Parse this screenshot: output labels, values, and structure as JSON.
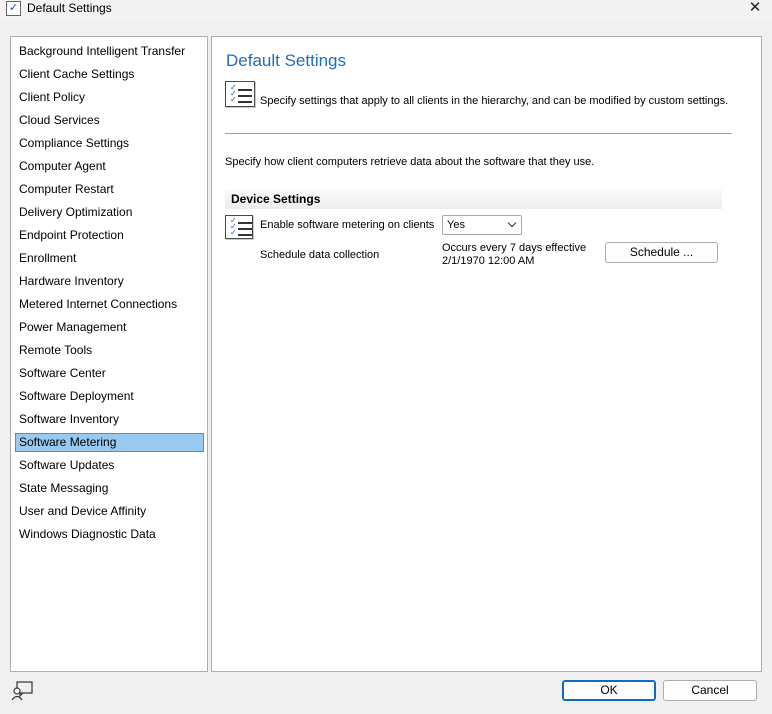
{
  "window": {
    "title": "Default Settings",
    "title_icon_glyph": "✓",
    "close_glyph": "✕"
  },
  "sidebar": {
    "selected_index": 17,
    "items": [
      {
        "label": "Background Intelligent Transfer"
      },
      {
        "label": "Client Cache Settings"
      },
      {
        "label": "Client Policy"
      },
      {
        "label": "Cloud Services"
      },
      {
        "label": "Compliance Settings"
      },
      {
        "label": "Computer Agent"
      },
      {
        "label": "Computer Restart"
      },
      {
        "label": "Delivery Optimization"
      },
      {
        "label": "Endpoint Protection"
      },
      {
        "label": "Enrollment"
      },
      {
        "label": "Hardware Inventory"
      },
      {
        "label": "Metered Internet Connections"
      },
      {
        "label": "Power Management"
      },
      {
        "label": "Remote Tools"
      },
      {
        "label": "Software Center"
      },
      {
        "label": "Software Deployment"
      },
      {
        "label": "Software Inventory"
      },
      {
        "label": "Software Metering"
      },
      {
        "label": "Software Updates"
      },
      {
        "label": "State Messaging"
      },
      {
        "label": "User and Device Affinity"
      },
      {
        "label": "Windows Diagnostic Data"
      }
    ]
  },
  "main": {
    "title": "Default Settings",
    "description": "Specify settings that apply to all clients in the hierarchy, and can be modified by custom settings.",
    "sub_description": "Specify how client computers retrieve data about the software that they use.",
    "group_title": "Device Settings",
    "settings": {
      "metering_label": "Enable software metering on clients",
      "metering_value": "Yes",
      "schedule_label": "Schedule data collection",
      "schedule_line1": "Occurs every 7 days effective",
      "schedule_line2": "2/1/1970 12:00 AM",
      "schedule_button": "Schedule ..."
    }
  },
  "footer": {
    "ok_label": "OK",
    "cancel_label": "Cancel"
  },
  "colors": {
    "title_accent": "#1f6fb5",
    "selection_bg": "#99c9ef",
    "selection_border": "#4a90d9",
    "primary_button_border": "#0f6cbd"
  }
}
